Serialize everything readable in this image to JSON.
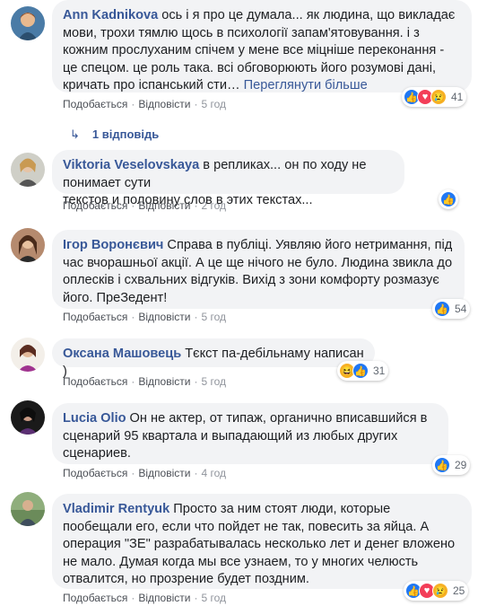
{
  "comments": [
    {
      "author": "Ann Kadnikova",
      "text_lines": [
        "ось і я про це думала... як людина, що викладає",
        "мови, трохи тямлю щось в психології запам'ятовування. і з",
        "кожним прослуханим спічем у мене все міцніше переконання -",
        "це спецом. це роль така. всі обговорюють його розумові дані,",
        "кричать про іспанський сти…"
      ],
      "see_more": "Переглянути більше",
      "like": "Подобається",
      "reply": "Відповісти",
      "time": "5 год",
      "reactions": [
        "like",
        "love",
        "sad"
      ],
      "count": "41"
    },
    {
      "author": "Viktoria Veselovskaya",
      "text_lines": [
        "в репликах... он по ходу не понимает сути",
        "текстов и половину слов в этих текстах..."
      ],
      "like": "Подобається",
      "reply": "Відповісти",
      "time": "2 год",
      "reactions": [
        "like"
      ],
      "count": ""
    },
    {
      "author": "Ігор Воронєвич",
      "text_lines": [
        "Справа в публіці. Уявляю його нетримання, під",
        "час вчорашньої акції. А це ще нічого не було. Людина звикла до",
        "оплесків і схвальних відгуків. Вихід з зони комфорту розмазує",
        "його. ПреЗедент!"
      ],
      "like": "Подобається",
      "reply": "Відповісти",
      "time": "5 год",
      "reactions": [
        "like"
      ],
      "count": "54"
    },
    {
      "author": "Оксана Машовець",
      "text_lines": [
        "Тєкст па-дебільнаму написан )"
      ],
      "like": "Подобається",
      "reply": "Відповісти",
      "time": "5 год",
      "reactions": [
        "haha",
        "like"
      ],
      "count": "31"
    },
    {
      "author": "Lucia Olio",
      "text_lines": [
        "Он не актер, от типаж, органично вписавшийся в",
        "сценарий 95 квартала и выпадающий из любых других",
        "сценариев."
      ],
      "like": "Подобається",
      "reply": "Відповісти",
      "time": "4 год",
      "reactions": [
        "like"
      ],
      "count": "29"
    },
    {
      "author": "Vladimir Rentyuk",
      "text_lines": [
        "Просто за ним стоят люди, которые",
        "пообещали его, если что пойдет не так, повесить за яйца. А",
        "операция \"ЗЕ\" разрабатывалась несколько лет и денег вложено",
        "не мало. Думая когда мы все узнаем, то у многих челюсть",
        "отвалится, но прозрение будет поздним."
      ],
      "like": "Подобається",
      "reply": "Відповісти",
      "time": "5 год",
      "reactions": [
        "like",
        "love",
        "sad"
      ],
      "count": "25"
    }
  ],
  "replies_link": "1 відповідь",
  "colors": {
    "link": "#385898",
    "bubble": "#f2f3f5",
    "like": "#2078f4",
    "love": "#f33e58",
    "sad": "#f7b125"
  }
}
